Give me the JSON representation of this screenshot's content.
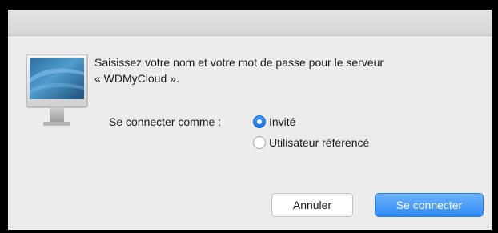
{
  "dialog": {
    "message_line1": "Saisissez votre nom et votre mot de passe pour le serveur",
    "message_line2": "« WDMyCloud ».",
    "connect_as_label": "Se connecter comme :",
    "options": [
      {
        "label": "Invité",
        "selected": true
      },
      {
        "label": "Utilisateur référencé",
        "selected": false
      }
    ],
    "cancel_label": "Annuler",
    "connect_label": "Se connecter",
    "icon": "monitor-icon",
    "accent_color": "#2f8bf6"
  }
}
